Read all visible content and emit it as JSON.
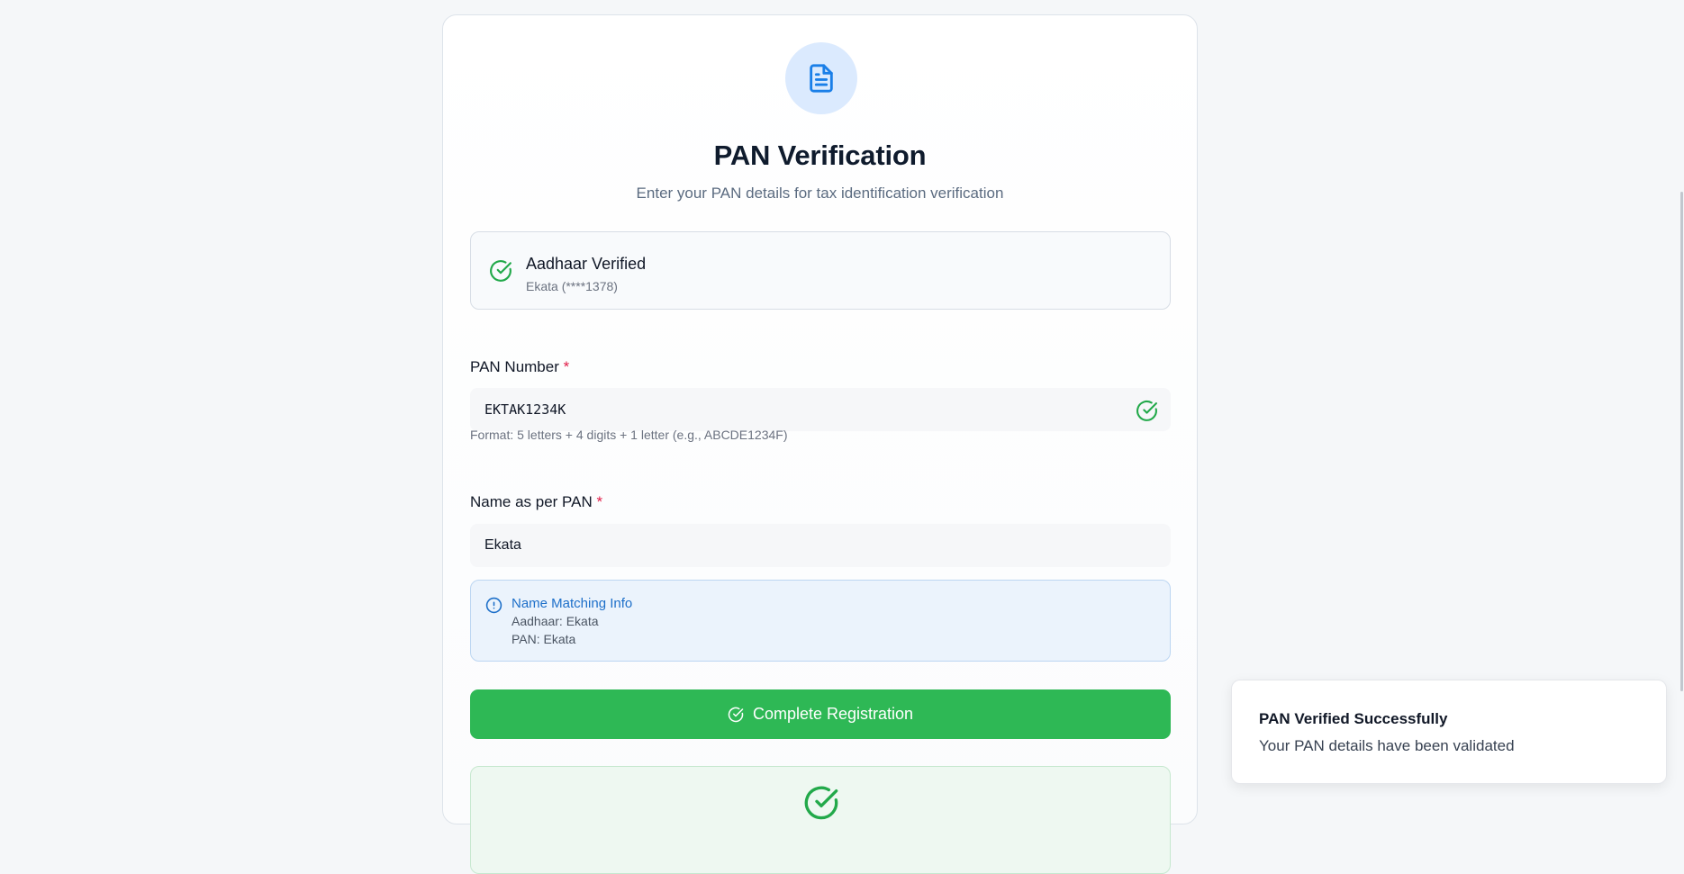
{
  "header": {
    "title": "PAN Verification",
    "subtitle": "Enter your PAN details for tax identification verification",
    "icon": "document-icon"
  },
  "aadhaar": {
    "title": "Aadhaar Verified",
    "detail": "Ekata (****1378)",
    "icon": "check-circle-icon"
  },
  "form": {
    "pan_label": "PAN Number",
    "pan_value": "EKTAK1234K",
    "pan_hint": "Format: 5 letters + 4 digits + 1 letter (e.g., ABCDE1234F)",
    "name_label": "Name as per PAN",
    "name_value": "Ekata",
    "required_mark": "*"
  },
  "name_match": {
    "title": "Name Matching Info",
    "aadhaar_line": "Aadhaar: Ekata",
    "pan_line": "PAN: Ekata",
    "icon": "info-icon"
  },
  "actions": {
    "complete_label": "Complete Registration"
  },
  "toast": {
    "title": "PAN Verified Successfully",
    "message": "Your PAN details have been validated"
  },
  "colors": {
    "primary_blue": "#1a7fe8",
    "success_green": "#2eb855",
    "required_red": "#e11d48"
  }
}
